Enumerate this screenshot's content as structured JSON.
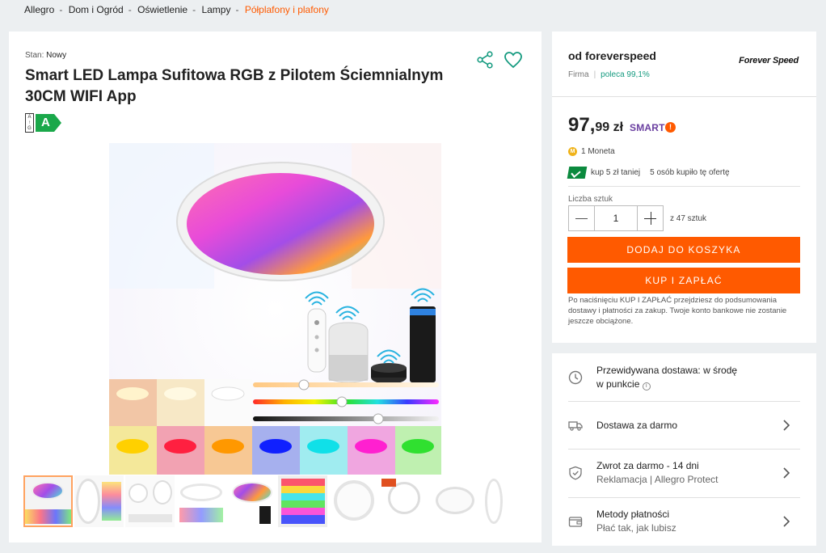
{
  "breadcrumb": {
    "items": [
      "Allegro",
      "Dom i Ogród",
      "Oświetlenie",
      "Lampy"
    ],
    "current": "Półplafony i plafony"
  },
  "product": {
    "condition_label": "Stan:",
    "condition_value": "Nowy",
    "title": "Smart LED Lampa Sufitowa RGB z Pilotem Ściemnialnym 30CM WIFI App",
    "energy_scale": [
      "A",
      "↑",
      "G"
    ],
    "energy_class": "A"
  },
  "seller": {
    "heading": "od foreverspeed",
    "logo_text": "Forever Speed",
    "type": "Firma",
    "rating": "poleca 99,1%"
  },
  "price": {
    "whole": "97,",
    "fraction": "99 zł",
    "smart_label": "SMART",
    "smart_mark": "!"
  },
  "coins": {
    "icon": "M",
    "label": "1 Moneta"
  },
  "promo": {
    "label": "kup 5 zł taniej",
    "bought": "5 osób kupiło tę ofertę"
  },
  "quantity": {
    "label": "Liczba sztuk",
    "value": "1",
    "of": "z 47 sztuk"
  },
  "buttons": {
    "add_to_cart": "DODAJ DO KOSZYKA",
    "buy_now": "KUP I ZAPŁAĆ"
  },
  "note": "Po naciśnięciu KUP I ZAPŁAĆ przejdziesz do podsumowania dostawy i płatności za zakup. Twoje konto bankowe nie zostanie jeszcze obciążone.",
  "delivery": {
    "eta_line1": "Przewidywana dostawa: w środę",
    "eta_line2": "w punkcie",
    "info_icon": "i",
    "free_delivery": "Dostawa za darmo",
    "returns_title": "Zwrot za darmo - 14 dni",
    "returns_sub": "Reklamacja | Allegro Protect",
    "payments_title": "Metody płatności",
    "payments_sub": "Płać tak, jak lubisz"
  },
  "colors": {
    "accent": "#ff5a00",
    "teal": "#149a7f",
    "smart_purple": "#6a3fa0",
    "energy_green": "#1aa84a"
  },
  "icons": [
    "share-icon",
    "heart-icon",
    "clock-icon",
    "truck-icon",
    "shield-icon",
    "wallet-icon",
    "chevron-right-icon",
    "coin-icon",
    "promo-check-icon"
  ]
}
